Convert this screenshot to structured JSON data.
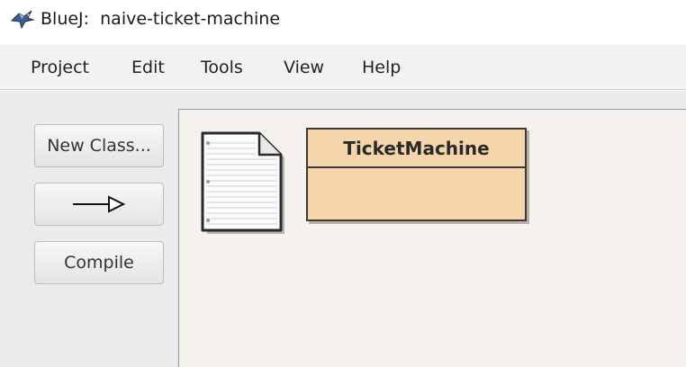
{
  "window": {
    "title": "BlueJ:  naive-ticket-machine",
    "icon": "bluej-bird-icon"
  },
  "menu": {
    "items": [
      "Project",
      "Edit",
      "Tools",
      "View",
      "Help"
    ]
  },
  "toolbar": {
    "new_class_label": "New Class...",
    "inheritance_arrow_icon": "inheritance-arrow-icon",
    "compile_label": "Compile"
  },
  "diagram": {
    "readme_icon": "readme-document-icon",
    "classes": [
      {
        "name": "TicketMachine"
      }
    ],
    "colors": {
      "class_fill": "#f5d5aa",
      "canvas_bg": "#f5f2ee"
    }
  }
}
